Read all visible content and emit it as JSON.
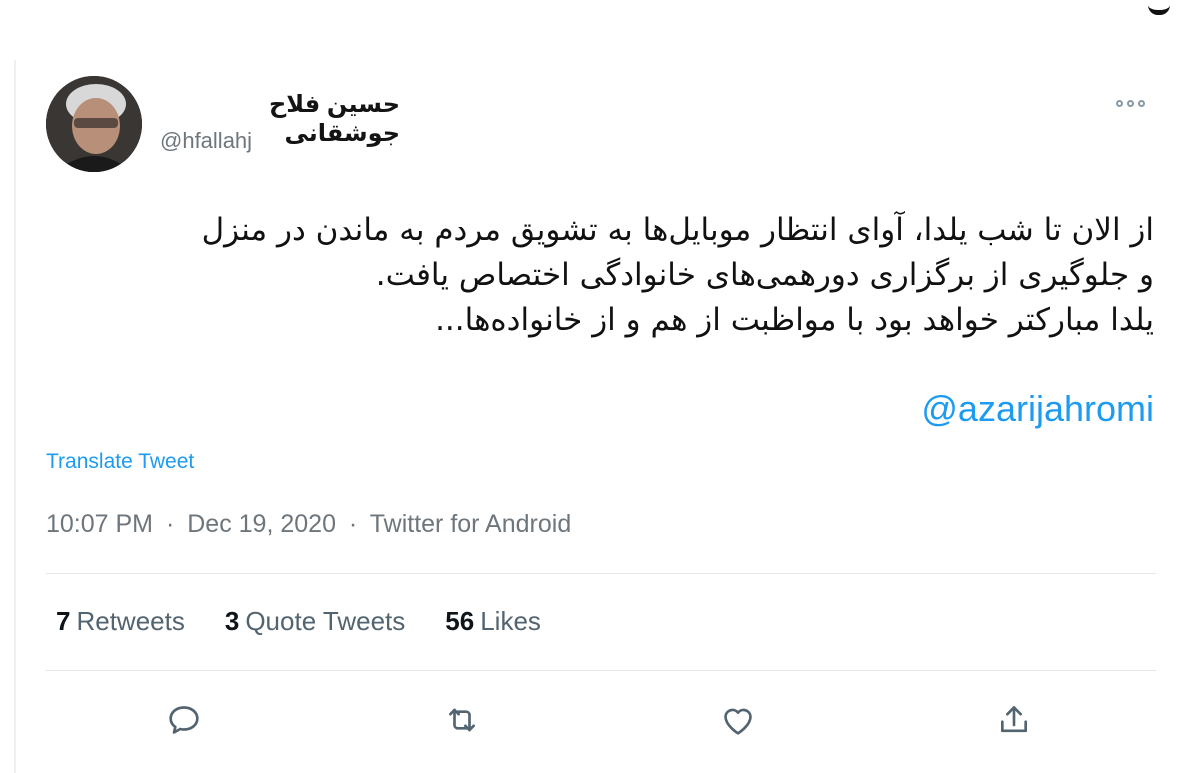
{
  "author": {
    "name": "حسین فلاح جوشقانی",
    "handle": "@hfallahj"
  },
  "tweet": {
    "lines": [
      "از الان تا شب یلدا، آوای انتظار موبایل‌ها به تشویق مردم به ماندن در منزل",
      "و جلوگیری از برگزاری دورهمی‌های خانوادگی اختصاص یافت.",
      "یلدا مبارکتر خواهد بود با مواظبت از هم و از خانواده‌ها..."
    ],
    "mention": "@azarijahromi",
    "translate_label": "Translate Tweet"
  },
  "meta": {
    "time": "10:07 PM",
    "separator": "·",
    "date": "Dec 19, 2020",
    "source": "Twitter for Android"
  },
  "stats": {
    "retweets": {
      "count": "7",
      "label": "Retweets"
    },
    "quote_tweets": {
      "count": "3",
      "label": "Quote Tweets"
    },
    "likes": {
      "count": "56",
      "label": "Likes"
    }
  },
  "icons": {
    "more": "more-icon",
    "reply": "reply-icon",
    "retweet": "retweet-icon",
    "like": "heart-icon",
    "share": "share-icon"
  },
  "colors": {
    "link": "#1d9bf0",
    "secondary_text": "#6e767d",
    "icon": "#536471"
  }
}
